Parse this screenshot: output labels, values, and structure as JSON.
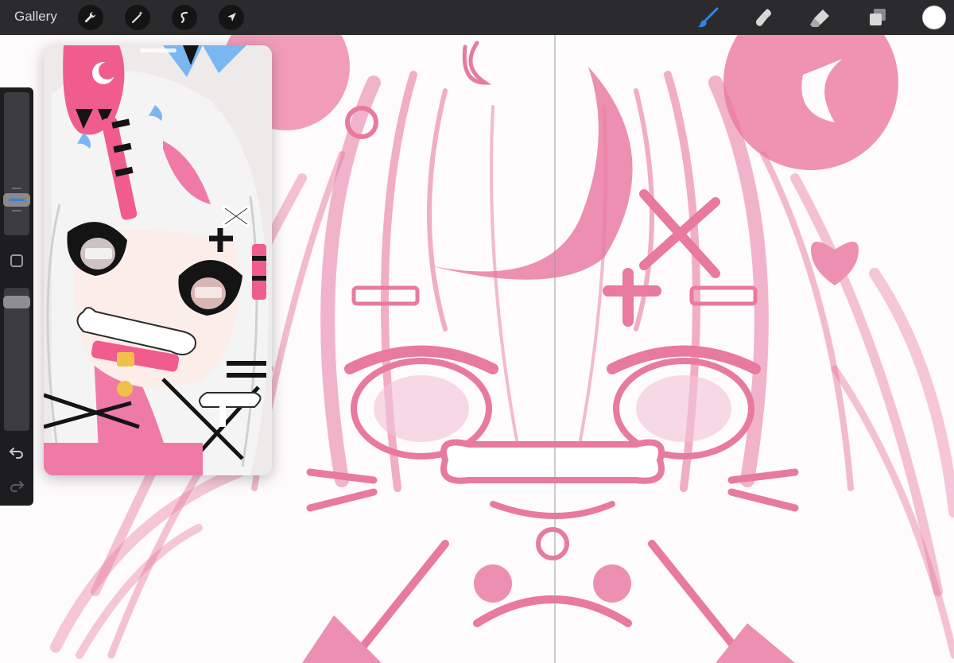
{
  "toolbar": {
    "gallery_label": "Gallery",
    "left_tools": [
      "wrench-icon",
      "magic-wand-icon",
      "selection-icon",
      "transform-arrow-icon"
    ],
    "right_tools": [
      "brush-icon",
      "smudge-icon",
      "eraser-icon",
      "layers-icon"
    ],
    "active_tool": "brush-icon",
    "active_tool_color": "#2f84e8",
    "current_color": "#ffffff"
  },
  "sidebar": {
    "tools": [
      "brush-size-slider",
      "modify-button",
      "opacity-slider",
      "undo-arrow-icon",
      "redo-arrow-icon"
    ],
    "accent_color": "#2f84e8"
  },
  "reference_window": {
    "description_colors": {
      "hair": "#eeeeee",
      "pink": "#f07aa6",
      "blue": "#7ab6f0",
      "black": "#141414"
    }
  },
  "canvas": {
    "sketch_color": "#e8799f",
    "background": "#fdfbfc",
    "symmetry_guide": true
  }
}
